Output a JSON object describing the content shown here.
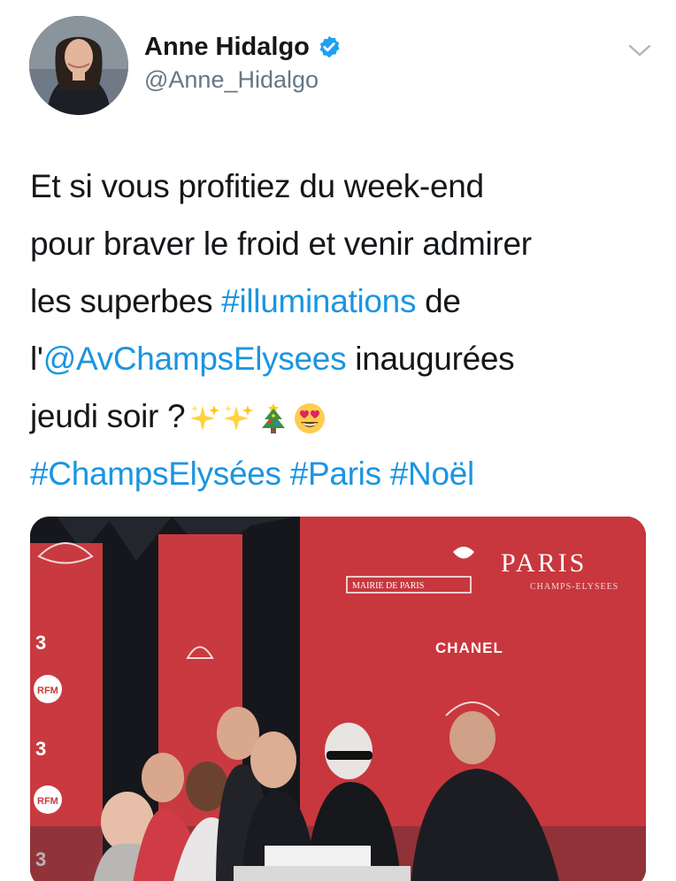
{
  "author": {
    "display_name": "Anne Hidalgo",
    "handle": "@Anne_Hidalgo",
    "verified": true,
    "avatar_icon": "profile-photo"
  },
  "tweet": {
    "text_parts": {
      "l1": "Et si vous profitiez du week-end",
      "l2": "pour braver le froid et venir admirer",
      "l3_pre": "les superbes ",
      "l3_tag": "#illuminations",
      "l3_post": " de",
      "l4_pre": "l'",
      "l4_mention": "@AvChampsElysees",
      "l4_post": " inaugurées",
      "l5": "jeudi soir ?",
      "tag1": "#ChampsElysées",
      "tag2": "#Paris",
      "tag3": "#Noël"
    },
    "emojis": [
      "sparkles-icon",
      "sparkles-icon",
      "christmas-tree-icon",
      "heart-eyes-icon"
    ]
  },
  "media": {
    "signs": {
      "paris": "PARIS",
      "champs": "CHAMPS-ELYSEES",
      "mairie": "MAIRIE DE PARIS",
      "chanel": "CHANEL",
      "rfm": "RFM"
    }
  },
  "colors": {
    "link": "#1b95e0",
    "verified": "#1da1f2",
    "stage_red": "#c83a3f",
    "secondary_text": "#657786"
  },
  "menu": {
    "caret_icon": "chevron-down-icon"
  }
}
